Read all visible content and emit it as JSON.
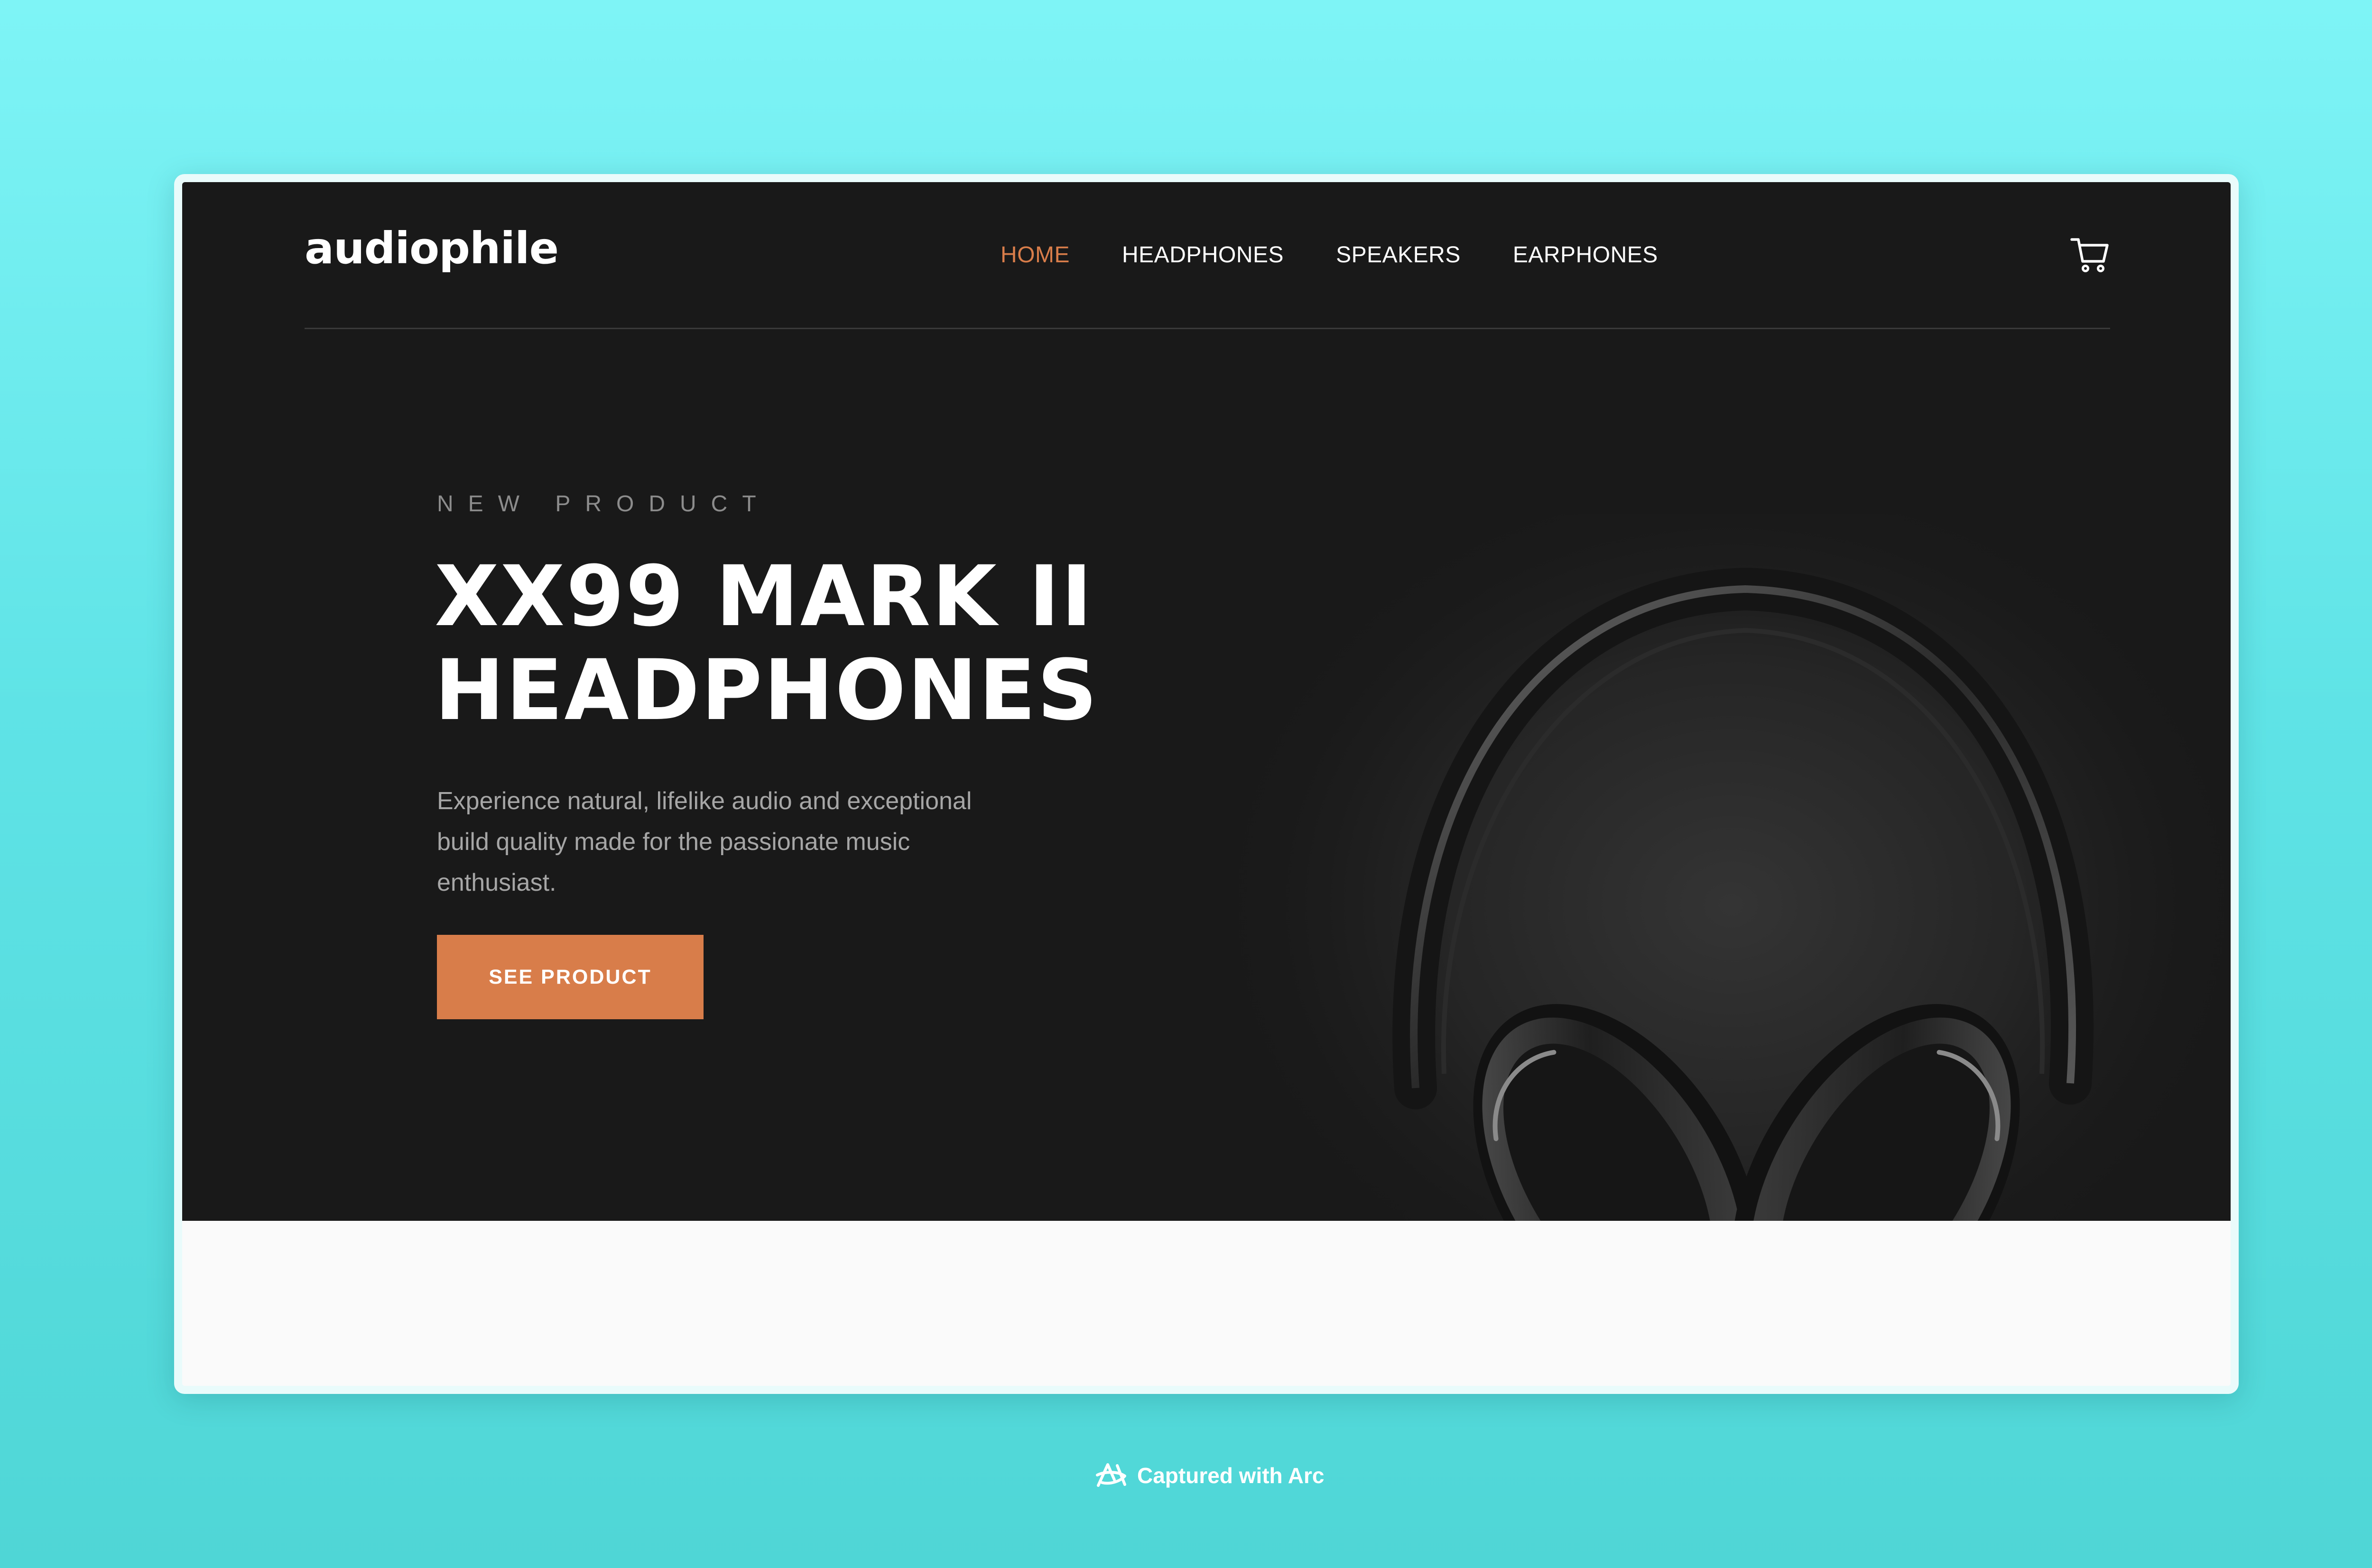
{
  "colors": {
    "accent": "#d87d4a",
    "hero_background": "#191919",
    "page_background": "#fafafa",
    "backdrop": "#5fe3e6"
  },
  "header": {
    "logo": "audiophile",
    "nav": [
      {
        "label": "HOME",
        "active": true
      },
      {
        "label": "HEADPHONES",
        "active": false
      },
      {
        "label": "SPEAKERS",
        "active": false
      },
      {
        "label": "EARPHONES",
        "active": false
      }
    ],
    "cart_icon": "cart-icon"
  },
  "hero": {
    "eyebrow": "NEW PRODUCT",
    "title_line1": "XX99 MARK II",
    "title_line2": "HEADPHONES",
    "description": "Experience natural, lifelike audio and exceptional build quality made for the passionate music enthusiast.",
    "cta_label": "SEE PRODUCT",
    "image_icon": "headphones-image"
  },
  "footer_caption": {
    "icon": "arc-logo-icon",
    "text": "Captured with Arc"
  }
}
